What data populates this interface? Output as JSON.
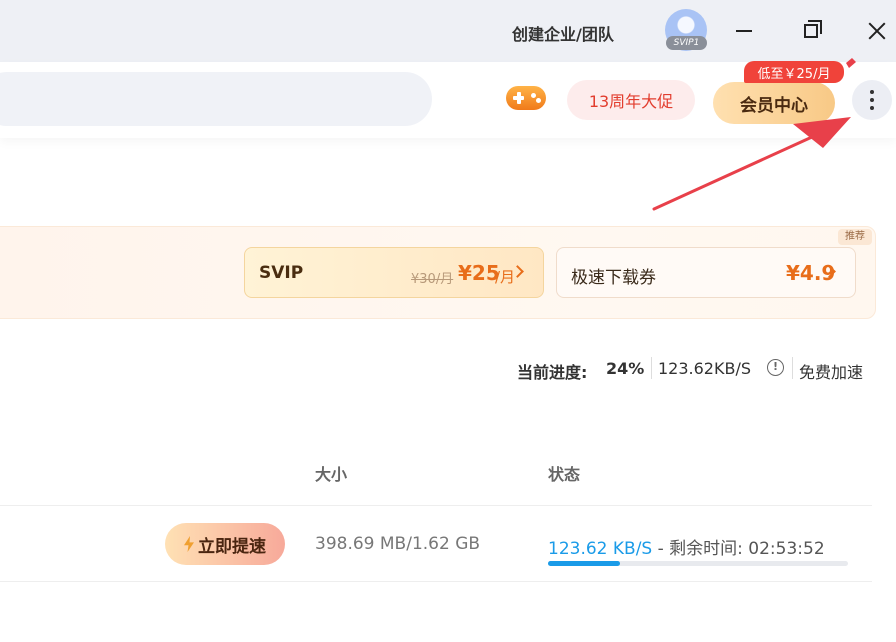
{
  "titlebar": {
    "team_link": "创建企业/团队",
    "avatar_badge": "SVIP1"
  },
  "header": {
    "promo_label": "13周年大促",
    "member_label": "会员中心",
    "price_tag": "低至￥25/月",
    "icons": [
      "game-controller-icon",
      "more-vertical-icon"
    ]
  },
  "banner": {
    "recommend_tag": "推荐",
    "svip": {
      "title": "SVIP",
      "old_price": "¥30/月",
      "price": "¥25",
      "unit": "/月"
    },
    "ticket": {
      "title": "极速下载券",
      "price": "¥4.9"
    }
  },
  "progress": {
    "label": "当前进度:",
    "percent": "24%",
    "speed": "123.62KB/S",
    "boost_link": "免费加速"
  },
  "table": {
    "headers": [
      "大小",
      "状态"
    ],
    "rows": [
      {
        "boost_button": "立即提速",
        "size": "398.69 MB/1.62 GB",
        "status_speed": "123.62 KB/S",
        "status_rest": " - 剩余时间: 02:53:52",
        "progress_fraction": 0.24
      }
    ]
  },
  "colors": {
    "accent_blue": "#1a9be8",
    "promo_red": "#e23d2e",
    "price_orange": "#e86d1a",
    "arrow_red": "#e8404a"
  }
}
